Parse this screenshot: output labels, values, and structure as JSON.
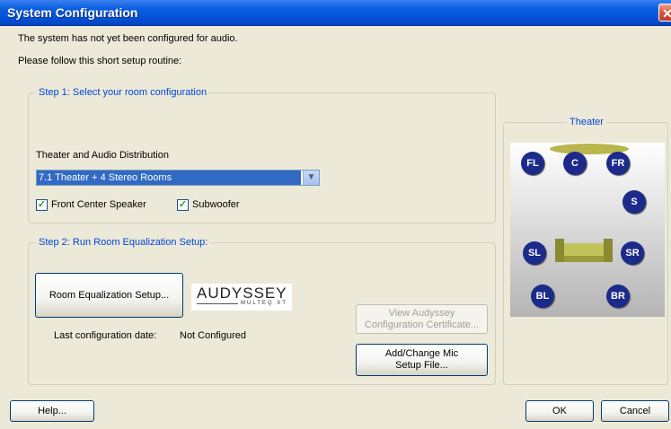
{
  "window": {
    "title": "System Configuration",
    "close_icon": "close-x-icon"
  },
  "intro": {
    "line1": "The system has not yet been configured for audio.",
    "line2": "Please follow this short setup routine:"
  },
  "step1": {
    "legend": "Step 1:    Select your room configuration",
    "distribution_label": "Theater and Audio Distribution",
    "distribution_value": "7.1 Theater + 4 Stereo Rooms",
    "front_center": {
      "label": "Front Center Speaker",
      "checked": true
    },
    "subwoofer": {
      "label": "Subwoofer",
      "checked": true
    }
  },
  "step2": {
    "legend": "Step 2:    Run Room Equalization Setup:",
    "room_eq_button": "Room Equalization Setup...",
    "audyssey_logo": "AUDYSSEY",
    "audyssey_sub": "MULTEQ XT",
    "view_cert_line1": "View Audyssey",
    "view_cert_line2": "Configuration Certificate...",
    "last_config_label": "Last configuration date:",
    "last_config_value": "Not Configured",
    "mic_line1": "Add/Change Mic",
    "mic_line2": "Setup File..."
  },
  "theater": {
    "legend": "Theater",
    "speakers": {
      "fl": "FL",
      "c": "C",
      "fr": "FR",
      "s": "S",
      "sl": "SL",
      "sr": "SR",
      "bl": "BL",
      "br": "BR"
    }
  },
  "footer": {
    "help": "Help...",
    "ok": "OK",
    "cancel": "Cancel"
  },
  "colors": {
    "title_bar": "#0552d6",
    "legend_text": "#0046d5",
    "speaker": "#1c2a8a",
    "selection": "#316ac5"
  }
}
